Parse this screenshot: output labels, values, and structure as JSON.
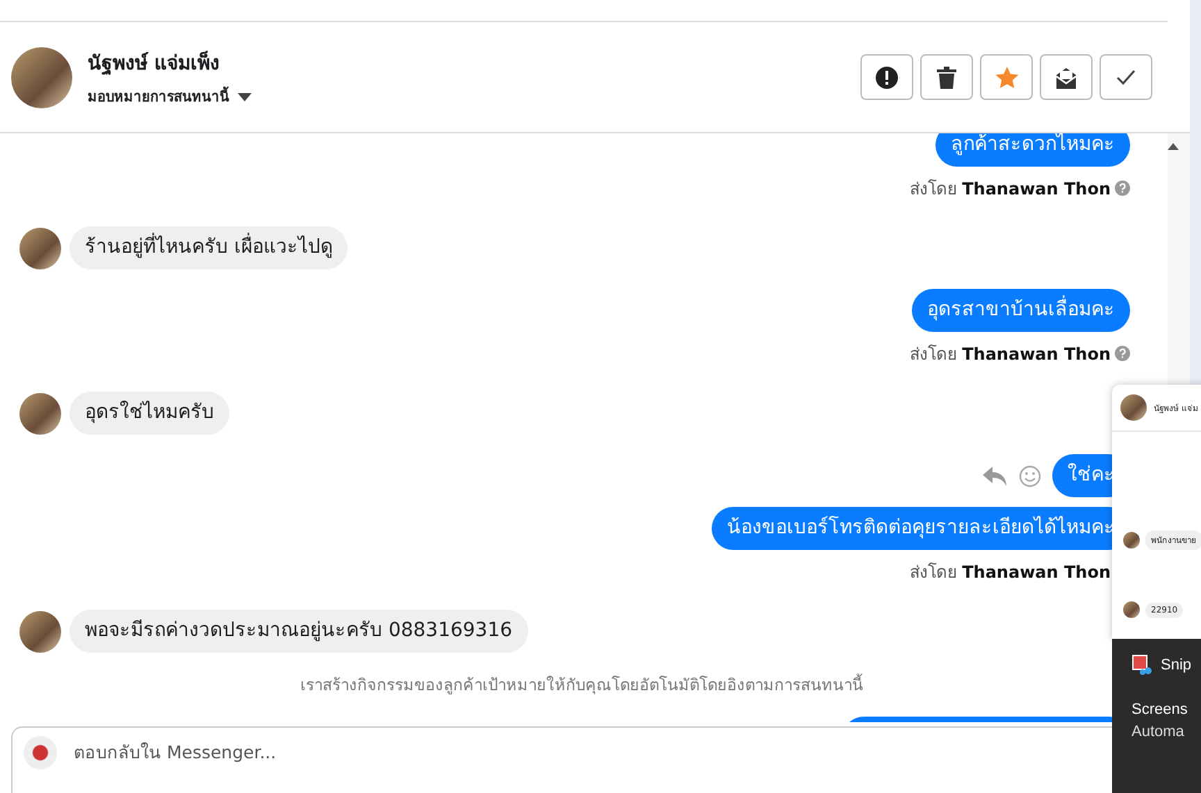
{
  "header": {
    "name": "นัฐพงษ์ แจ่มเพ็ง",
    "assign_label": "มอบหมายการสนทนานี้",
    "actions": [
      {
        "kind": "alert"
      },
      {
        "kind": "trash"
      },
      {
        "kind": "star",
        "on": true
      },
      {
        "kind": "mail"
      },
      {
        "kind": "check"
      }
    ]
  },
  "messages": [
    {
      "kind": "out",
      "text": "ลูกค้าสะดวกไหมคะ"
    },
    {
      "kind": "sent_by",
      "prefix": "ส่งโดย",
      "agent": "Thanawan Thon"
    },
    {
      "kind": "in",
      "text": "ร้านอยู่ที่ไหนครับ เผื่อแวะไปดู"
    },
    {
      "kind": "out",
      "text": "อุดรสาขาบ้านเลื่อมคะ"
    },
    {
      "kind": "sent_by",
      "prefix": "ส่งโดย",
      "agent": "Thanawan Thon"
    },
    {
      "kind": "in",
      "text": "อุดรใช่ไหมครับ"
    },
    {
      "kind": "out",
      "text": "ใช่คะ",
      "hover_icons": true
    },
    {
      "kind": "out",
      "text": "น้องขอเบอร์โทรติดต่อคุยรายละเอียดได้ไหมคะ"
    },
    {
      "kind": "sent_by",
      "prefix": "ส่งโดย",
      "agent": "Thanawan Thon"
    },
    {
      "kind": "in",
      "text": "พอจะมีรถค่างวดประมาณอยู่นะครับ 0883169316"
    },
    {
      "kind": "system",
      "text": "เราสร้างกิจกรรมของลูกค้าเป้าหมายให้กับคุณโดยอัตโนมัติโดยอิงตามการสนทนานี้"
    },
    {
      "kind": "out_cut"
    }
  ],
  "composer": {
    "placeholder": "ตอบกลับใน Messenger..."
  },
  "popup": {
    "name": "นัฐพงษ์ แจ่ม",
    "messages": [
      "พนักงานขาย",
      "22910"
    ]
  },
  "toast": {
    "app": "Snip",
    "title": "Screens",
    "body": "Automa"
  }
}
